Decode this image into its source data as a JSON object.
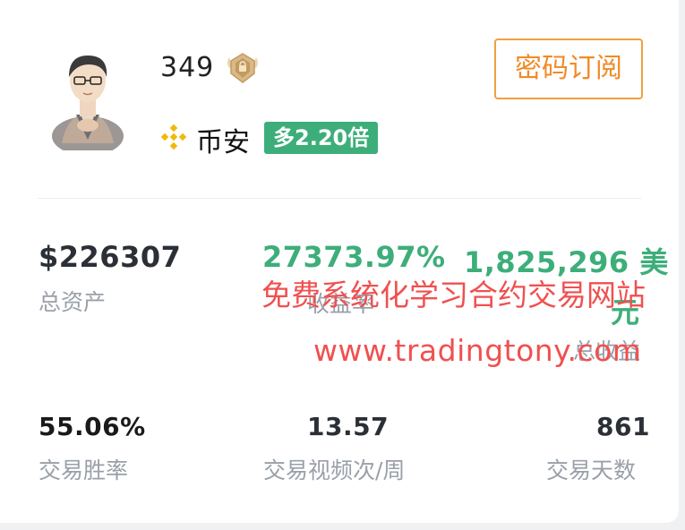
{
  "profile": {
    "username": "349",
    "exchange": "币安",
    "leverage_badge": "多2.20倍",
    "subscribe_label": "密码订阅"
  },
  "stats_row1": {
    "total_assets": {
      "value": "$226307",
      "label": "总资产"
    },
    "yield": {
      "value": "27373.97%",
      "label": "收益率"
    },
    "total_profit": {
      "value": "1,825,296 美",
      "value_line2": "元",
      "label": "总收益"
    }
  },
  "stats_row2": {
    "win_rate": {
      "value": "55.06%",
      "label": "交易胜率"
    },
    "weekly_trades": {
      "value": "13.57",
      "label": "交易视频次/周"
    },
    "trading_days": {
      "value": "861",
      "label": "交易天数"
    }
  },
  "watermark": {
    "line1": "免费系统化学习合约交易网站",
    "line2": "www.tradingtony.com"
  },
  "colors": {
    "accent_green": "#3dae7a",
    "accent_orange": "#f08a28",
    "watermark_red": "#f05050",
    "binance_yellow": "#f0b90b"
  },
  "icons": {
    "avatar": "user-avatar",
    "rank_badge": "rank-badge-icon",
    "exchange": "binance-logo-icon"
  }
}
